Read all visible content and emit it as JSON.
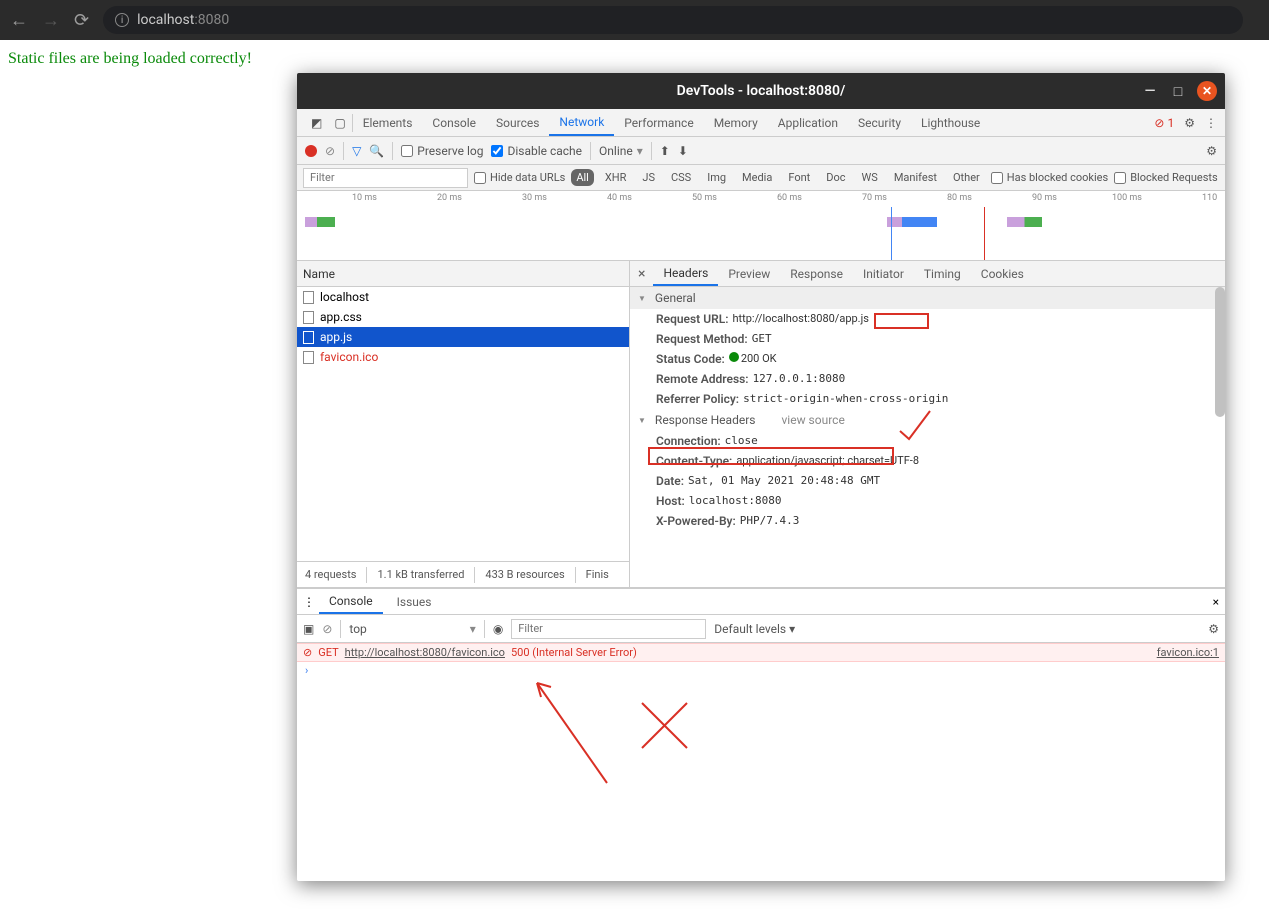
{
  "browser": {
    "url_host": "localhost",
    "url_port": ":8080"
  },
  "page": {
    "text": "Static files are being loaded correctly!"
  },
  "devtools": {
    "title": "DevTools - localhost:8080/",
    "tabs": [
      "Elements",
      "Console",
      "Sources",
      "Network",
      "Performance",
      "Memory",
      "Application",
      "Security",
      "Lighthouse"
    ],
    "active_tab": "Network",
    "error_count": "1",
    "net_toolbar": {
      "preserve_log": "Preserve log",
      "disable_cache": "Disable cache",
      "throttle": "Online"
    },
    "filter_placeholder": "Filter",
    "hide_data_urls": "Hide data URLs",
    "filter_types": [
      "All",
      "XHR",
      "JS",
      "CSS",
      "Img",
      "Media",
      "Font",
      "Doc",
      "WS",
      "Manifest",
      "Other"
    ],
    "extra_filters": [
      "Has blocked cookies",
      "Blocked Requests"
    ],
    "timeline_ticks": [
      "10 ms",
      "20 ms",
      "30 ms",
      "40 ms",
      "50 ms",
      "60 ms",
      "70 ms",
      "80 ms",
      "90 ms",
      "100 ms",
      "110"
    ],
    "req_header": "Name",
    "requests": [
      {
        "name": "localhost",
        "selected": false,
        "err": false
      },
      {
        "name": "app.css",
        "selected": false,
        "err": false
      },
      {
        "name": "app.js",
        "selected": true,
        "err": false
      },
      {
        "name": "favicon.ico",
        "selected": false,
        "err": true
      }
    ],
    "footer": {
      "requests": "4 requests",
      "transferred": "1.1 kB transferred",
      "resources": "433 B resources",
      "finish": "Finis"
    },
    "detail_tabs": [
      "Headers",
      "Preview",
      "Response",
      "Initiator",
      "Timing",
      "Cookies"
    ],
    "active_detail": "Headers",
    "general_label": "General",
    "general": [
      {
        "k": "Request URL:",
        "v": "http://localhost:8080/",
        "v2": "app.js"
      },
      {
        "k": "Request Method:",
        "v": "GET"
      },
      {
        "k": "Status Code:",
        "v": "200 OK",
        "dot": true
      },
      {
        "k": "Remote Address:",
        "v": "127.0.0.1:8080"
      },
      {
        "k": "Referrer Policy:",
        "v": "strict-origin-when-cross-origin"
      }
    ],
    "response_headers_label": "Response Headers",
    "view_source": "view source",
    "response_headers": [
      {
        "k": "Connection:",
        "v": "close"
      },
      {
        "k": "Content-Type:",
        "v": "application/javascript;",
        "v2": " charset=UTF-8"
      },
      {
        "k": "Date:",
        "v": "Sat, 01 May 2021 20:48:48 GMT"
      },
      {
        "k": "Host:",
        "v": "localhost:8080"
      },
      {
        "k": "X-Powered-By:",
        "v": "PHP/7.4.3"
      }
    ]
  },
  "console": {
    "tabs": [
      "Console",
      "Issues"
    ],
    "context": "top",
    "filter_placeholder": "Filter",
    "levels": "Default levels",
    "error": {
      "method": "GET",
      "url": "http://localhost:8080/favicon.ico",
      "status": "500 (Internal Server Error)",
      "source": "favicon.ico:1"
    }
  }
}
